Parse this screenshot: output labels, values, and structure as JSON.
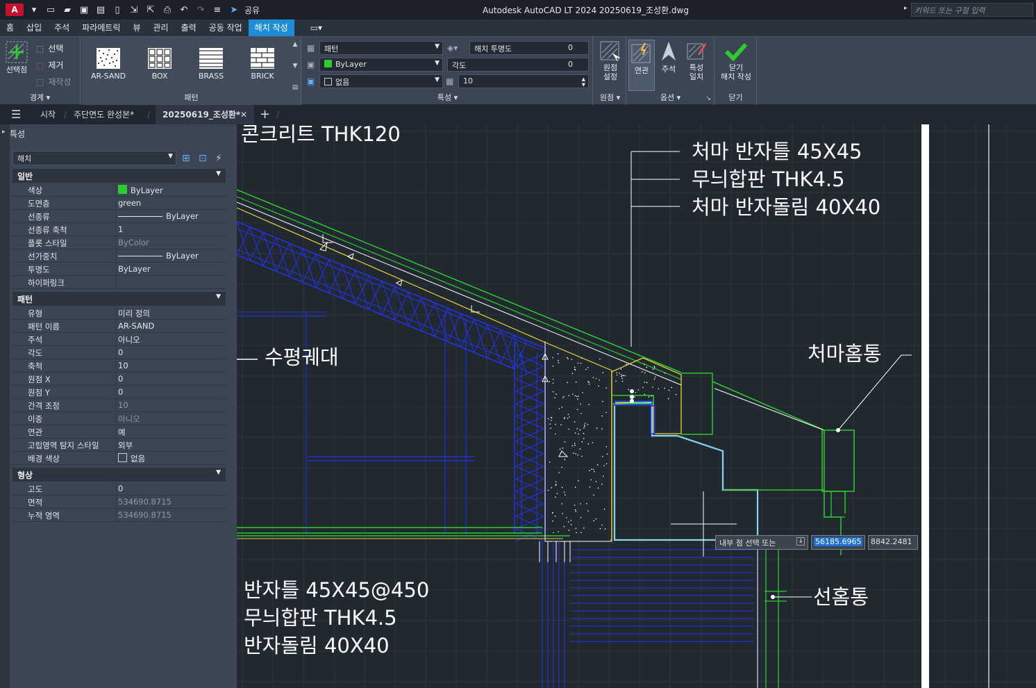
{
  "app": {
    "title": "Autodesk AutoCAD LT 2024    20250619_조성환.dwg",
    "logo": "A",
    "share_label": "공유",
    "search_placeholder": "키워드 또는 구절 입력"
  },
  "menu_tabs": [
    "홈",
    "삽입",
    "주석",
    "파라메트릭",
    "뷰",
    "관리",
    "출력",
    "공동 작업",
    "해치 작성"
  ],
  "ribbon": {
    "boundary": {
      "pick_points": "선택점",
      "select": "선택",
      "remove": "제거",
      "recreate": "재작성",
      "panel": "경계"
    },
    "patterns": [
      {
        "name": "AR-SAND"
      },
      {
        "name": "BOX"
      },
      {
        "name": "BRASS"
      },
      {
        "name": "BRICK"
      }
    ],
    "pattern_panel": "패턴",
    "properties": {
      "type": "패턴",
      "color": "ByLayer",
      "background": "없음",
      "transparency_label": "해치 투명도",
      "transparency_value": "0",
      "angle_label": "각도",
      "angle_value": "0",
      "scale_value": "10",
      "panel": "특성"
    },
    "origin": {
      "set_origin": "원점\n설정",
      "panel": "원점"
    },
    "options": {
      "associative": "연관",
      "annotative": "주석",
      "match_props": "특성\n일치",
      "panel": "옵션"
    },
    "close": {
      "label": "닫기\n해치 작성",
      "panel": "닫기"
    },
    "colors": {
      "accent": "#1f8cd8",
      "green": "#2dcc2d"
    }
  },
  "doc_tabs": {
    "start": "시작",
    "tab1": "주단면도 완성본*",
    "tab2": "20250619_조성환*",
    "add": "+"
  },
  "properties_palette": {
    "title": "특성",
    "selection": "해치",
    "sections": [
      {
        "name": "일반",
        "rows": [
          {
            "k": "색상",
            "v": "ByLayer"
          },
          {
            "k": "도면층",
            "v": "green"
          },
          {
            "k": "선종류",
            "v": "ByLayer"
          },
          {
            "k": "선종류 축척",
            "v": "1"
          },
          {
            "k": "플롯 스타일",
            "v": "ByColor"
          },
          {
            "k": "선가중치",
            "v": "ByLayer"
          },
          {
            "k": "투명도",
            "v": "ByLayer"
          },
          {
            "k": "하이퍼링크",
            "v": ""
          }
        ]
      },
      {
        "name": "패턴",
        "rows": [
          {
            "k": "유형",
            "v": "미리 정의"
          },
          {
            "k": "패턴 이름",
            "v": "AR-SAND"
          },
          {
            "k": "주석",
            "v": "아니오"
          },
          {
            "k": "각도",
            "v": "0"
          },
          {
            "k": "축척",
            "v": "10"
          },
          {
            "k": "원점 X",
            "v": "0"
          },
          {
            "k": "원점 Y",
            "v": "0"
          },
          {
            "k": "간격 조정",
            "v": "10"
          },
          {
            "k": "이중",
            "v": "아니오"
          },
          {
            "k": "연관",
            "v": "예"
          },
          {
            "k": "고립영역 탐지 스타일",
            "v": "외부"
          },
          {
            "k": "배경 색상",
            "v": "없음"
          }
        ]
      },
      {
        "name": "형상",
        "rows": [
          {
            "k": "고도",
            "v": "0"
          },
          {
            "k": "면적",
            "v": "534690.8715"
          },
          {
            "k": "누적 영역",
            "v": "534690.8715"
          }
        ]
      }
    ]
  },
  "drawing_text": {
    "t1": "콘크리트 THK120",
    "t2": "처마 반자틀 45X45",
    "t3": "무늬합판 THK4.5",
    "t4": "처마 반자돌림 40X40",
    "t5": "수평궤대",
    "t6": "처마홈통",
    "t7": "반자틀 45X45@450",
    "t8": "무늬합판 THK4.5",
    "t9": "반자돌림 40X40",
    "t10": "선홈통"
  },
  "command": {
    "prompt": "내부 점 선택 또는",
    "x": "56185.6965",
    "y": "8842.2481"
  }
}
